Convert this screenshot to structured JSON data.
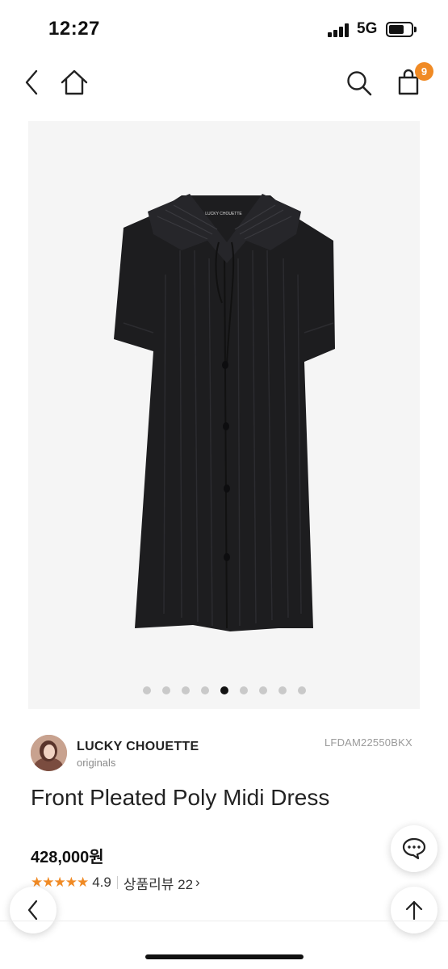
{
  "status_bar": {
    "time": "12:27",
    "network": "5G",
    "icons": [
      "signal-icon",
      "battery-icon"
    ]
  },
  "nav": {
    "icons": [
      "back-arrow-icon",
      "home-icon",
      "search-icon",
      "shopping-bag-icon"
    ],
    "cart_count": "9",
    "accent_color": "#f08a24"
  },
  "gallery": {
    "dot_count": 9,
    "active_index": 4
  },
  "brand": {
    "name": "LUCKY CHOUETTE",
    "sub": "originals",
    "label_on_garment": "LUCKY CHOUETTE"
  },
  "product": {
    "code": "LFDAM22550BKX",
    "title": "Front Pleated Poly Midi Dress",
    "price": "428,000원"
  },
  "rating": {
    "stars": "★★★★★",
    "value": "4.9",
    "review_label": "상품리뷰 22",
    "chevron": "›"
  },
  "floating": {
    "icons": [
      "chat-icon",
      "arrow-up-icon",
      "chevron-left-icon"
    ]
  }
}
